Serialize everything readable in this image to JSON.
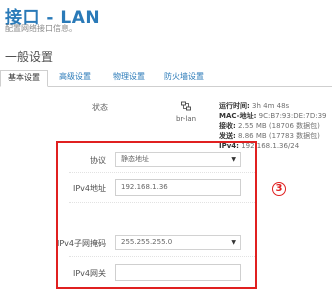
{
  "page": {
    "title": "接口 - LAN",
    "subtitle": "配置网络接口信息。",
    "section_title": "一般设置"
  },
  "tabs": [
    {
      "label": "基本设置",
      "active": true
    },
    {
      "label": "高级设置",
      "active": false
    },
    {
      "label": "物理设置",
      "active": false
    },
    {
      "label": "防火墙设置",
      "active": false
    }
  ],
  "status": {
    "label": "状态",
    "interface_name": "br-lan",
    "interface_icon": "network-interface-icon",
    "uptime_key": "运行时间:",
    "uptime_value": " 3h 4m 48s",
    "mac_key": "MAC-地址:",
    "mac_value": " 9C:B7:93:DE:7D:39",
    "rx_key": "接收:",
    "rx_value": " 2.55 MB (18706 数据包)",
    "tx_key": "发送:",
    "tx_value": " 8.86 MB (17783 数据包)",
    "ipv4_key": "IPv4:",
    "ipv4_value": " 192.168.1.36/24"
  },
  "form": {
    "protocol_label": "协议",
    "protocol_value": "静态地址",
    "ipv4_address_label": "IPv4地址",
    "ipv4_address_value": "192.168.1.36",
    "netmask_label": "IPv4子网掩码",
    "netmask_value": "255.255.255.0",
    "gateway_label": "IPv4网关",
    "gateway_value": ""
  },
  "annotation": {
    "marker_text": "3",
    "color": "#e02020"
  },
  "colors": {
    "accent": "#2a7ab8",
    "highlight": "#e02020"
  }
}
